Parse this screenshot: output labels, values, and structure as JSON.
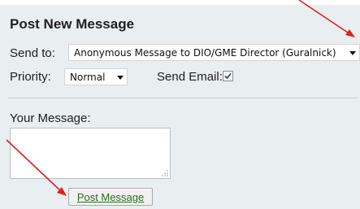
{
  "form": {
    "title": "Post New Message",
    "send_to_label": "Send to:",
    "send_to_value": "Anonymous Message to DIO/GME Director (Guralnick)",
    "priority_label": "Priority:",
    "priority_value": "Normal",
    "send_email_label": "Send Email:",
    "send_email_checked": true,
    "message_label": "Your Message:",
    "message_value": "",
    "submit_label": "Post Message"
  },
  "icons": {
    "dropdown": "chevron-down-icon",
    "checkbox": "checkmark-icon",
    "resize": "resize-grip-icon",
    "annotation": "arrow-icon"
  },
  "colors": {
    "panel_background": "#e9eef0",
    "submit_text": "#2b6f1a",
    "annotation_arrow": "#e0201b"
  }
}
